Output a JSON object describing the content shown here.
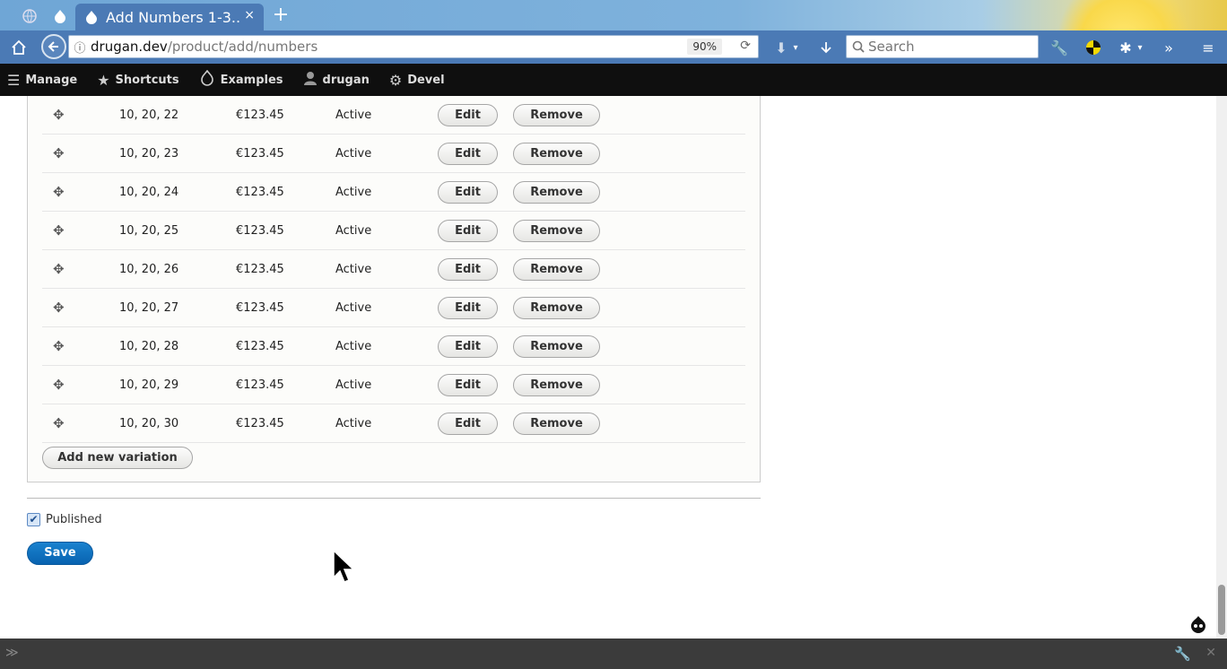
{
  "browser": {
    "tab_title": "Add Numbers 1-3...",
    "tab_close": "×",
    "new_tab": "+",
    "url_host": "drugan.dev",
    "url_path": "/product/add/numbers",
    "zoom": "90%",
    "search_placeholder": "Search"
  },
  "toolbar": {
    "items": [
      {
        "label": "Manage",
        "icon": "menu-icon"
      },
      {
        "label": "Shortcuts",
        "icon": "star-icon"
      },
      {
        "label": "Examples",
        "icon": "drupal-drop-icon"
      },
      {
        "label": "drugan",
        "icon": "user-icon"
      },
      {
        "label": "Devel",
        "icon": "gear-icon"
      }
    ]
  },
  "variations": [
    {
      "sku": "10, 20, 22",
      "price": "€123.45",
      "status": "Active"
    },
    {
      "sku": "10, 20, 23",
      "price": "€123.45",
      "status": "Active"
    },
    {
      "sku": "10, 20, 24",
      "price": "€123.45",
      "status": "Active"
    },
    {
      "sku": "10, 20, 25",
      "price": "€123.45",
      "status": "Active"
    },
    {
      "sku": "10, 20, 26",
      "price": "€123.45",
      "status": "Active"
    },
    {
      "sku": "10, 20, 27",
      "price": "€123.45",
      "status": "Active"
    },
    {
      "sku": "10, 20, 28",
      "price": "€123.45",
      "status": "Active"
    },
    {
      "sku": "10, 20, 29",
      "price": "€123.45",
      "status": "Active"
    },
    {
      "sku": "10, 20, 30",
      "price": "€123.45",
      "status": "Active"
    }
  ],
  "buttons": {
    "edit": "Edit",
    "remove": "Remove",
    "add_variation": "Add new variation",
    "save": "Save"
  },
  "published": {
    "label": "Published",
    "checked": true
  }
}
